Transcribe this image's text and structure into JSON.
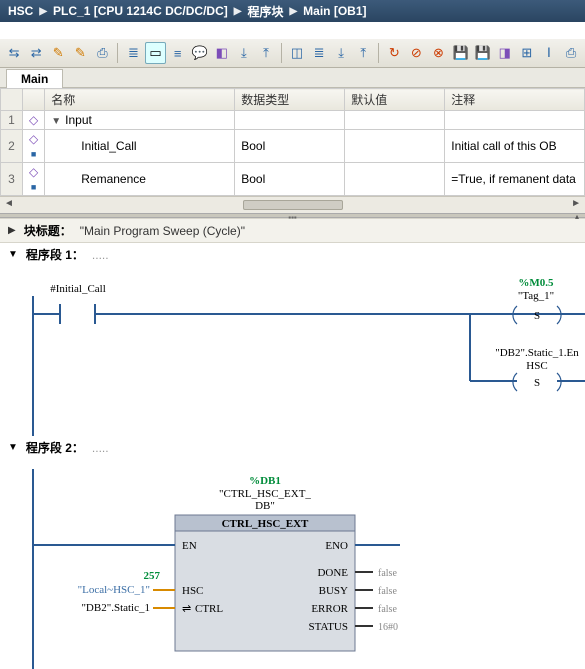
{
  "breadcrumb": [
    "HSC",
    "PLC_1 [CPU 1214C DC/DC/DC]",
    "程序块",
    "Main [OB1]"
  ],
  "tab": "Main",
  "columns": {
    "name": "名称",
    "dtype": "数据类型",
    "default": "默认值",
    "comment": "注释"
  },
  "rows": [
    {
      "n": "1",
      "kind": "group",
      "name": "Input",
      "dtype": "",
      "default": "",
      "comment": ""
    },
    {
      "n": "2",
      "kind": "var",
      "name": "Initial_Call",
      "dtype": "Bool",
      "default": "",
      "comment": "Initial call of this OB"
    },
    {
      "n": "3",
      "kind": "var",
      "name": "Remanence",
      "dtype": "Bool",
      "default": "",
      "comment": "=True, if remanent data"
    }
  ],
  "block_title": {
    "label": "块标题：",
    "value": "\"Main Program Sweep (Cycle)\""
  },
  "net1": {
    "title": "程序段 1：",
    "contact": "#Initial_Call",
    "coil1_addr": "%M0.5",
    "coil1_tag": "\"Tag_1\"",
    "coil1_type": "S",
    "coil2_tag": "\"DB2\".Static_1.En",
    "coil2_sub": "HSC",
    "coil2_type": "S"
  },
  "net2": {
    "title": "程序段 2：",
    "db": "%DB1",
    "db_name": "\"CTRL_HSC_EXT_\nDB\"",
    "fb_type": "CTRL_HSC_EXT",
    "in_en": "EN",
    "in_hsc": "HSC",
    "in_ctrl": "CTRL",
    "out_eno": "ENO",
    "out_done": "DONE",
    "out_busy": "BUSY",
    "out_error": "ERROR",
    "out_status": "STATUS",
    "hsc_val": "257",
    "hsc_tag": "\"Local~HSC_1\"",
    "ctrl_tag": "\"DB2\".Static_1",
    "done_v": "false",
    "busy_v": "false",
    "error_v": "false",
    "status_v": "16#0"
  }
}
